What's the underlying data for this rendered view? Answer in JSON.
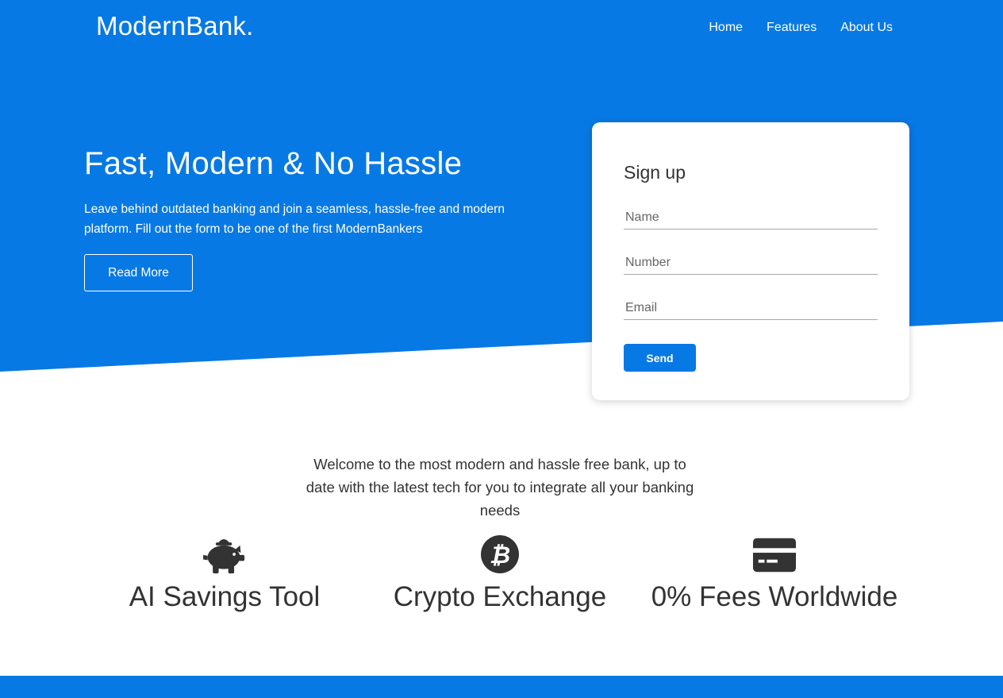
{
  "colors": {
    "brand_blue": "#0779e4",
    "text_dark": "#333333",
    "white": "#ffffff"
  },
  "nav": {
    "logo": "ModernBank.",
    "links": [
      "Home",
      "Features",
      "About Us"
    ]
  },
  "hero": {
    "title": "Fast, Modern & No Hassle",
    "text": "Leave behind outdated banking and join a seamless, hassle-free and modern platform. Fill out the form to be one of the first ModernBankers",
    "button_label": "Read More"
  },
  "signup": {
    "title": "Sign up",
    "name_placeholder": "Name",
    "number_placeholder": "Number",
    "email_placeholder": "Email",
    "send_label": "Send"
  },
  "welcome_text": "Welcome to the most modern and hassle free bank, up to date with the latest tech for you to integrate all your banking needs",
  "features": [
    {
      "icon": "piggy-bank-icon",
      "label": "AI Savings Tool"
    },
    {
      "icon": "bitcoin-icon",
      "label": "Crypto Exchange"
    },
    {
      "icon": "credit-card-icon",
      "label": "0% Fees Worldwide"
    }
  ]
}
